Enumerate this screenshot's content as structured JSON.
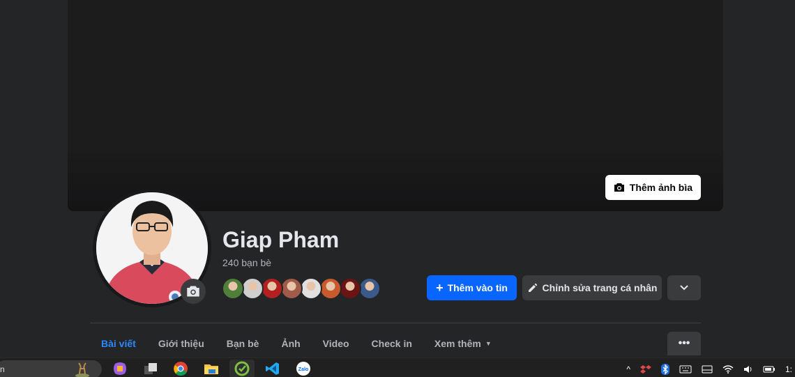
{
  "cover": {
    "add_cover_label": "Thêm ảnh bìa"
  },
  "profile": {
    "name": "Giap Pham",
    "friends_count_text": "240 bạn bè",
    "friend_avatar_colors": [
      "#4f7f3a",
      "#cfcfcf",
      "#b22020",
      "#a05b4a",
      "#e0e0e0",
      "#c95a2e",
      "#6b1414",
      "#3a5a8a"
    ]
  },
  "actions": {
    "add_to_story_label": "Thêm vào tin",
    "edit_profile_label": "Chỉnh sửa trang cá nhân"
  },
  "tabs": [
    {
      "label": "Bài viết",
      "active": true
    },
    {
      "label": "Giới thiệu"
    },
    {
      "label": "Bạn bè"
    },
    {
      "label": "Ảnh"
    },
    {
      "label": "Video"
    },
    {
      "label": "Check in"
    },
    {
      "label": "Xem thêm",
      "has_caret": true
    }
  ],
  "taskbar": {
    "search_text": "n",
    "clock_fragment": "1:"
  },
  "colors": {
    "primary": "#0866ff",
    "active_tab": "#2d88ff",
    "background": "#242526"
  }
}
